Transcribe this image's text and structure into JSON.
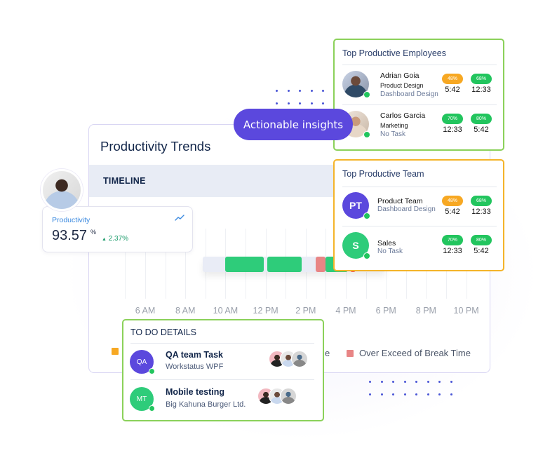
{
  "colors": {
    "brand_purple": "#5b48dd",
    "success_green": "#22c55e",
    "warning_orange": "#f7a823",
    "productive_bar": "#2ecc7a",
    "break_exceed": "#e88585",
    "over_break": "#f0505a",
    "idle": "#e9ecf6",
    "employees_border": "#8bd15a",
    "team_border": "#f4b42a"
  },
  "pill": {
    "label": "Actionable insights"
  },
  "main": {
    "title": "Productivity Trends",
    "timeline_label": "TIMELINE",
    "time_axis": [
      "6 AM",
      "8 AM",
      "10 AM",
      "12 PM",
      "2 PM",
      "4 PM",
      "6 PM",
      "8 PM",
      "10 PM"
    ],
    "timeline_segments": [
      {
        "type": "productive",
        "start_hour": 10.0,
        "end_hour": 12.0
      },
      {
        "type": "productive",
        "start_hour": 12.1,
        "end_hour": 13.9
      },
      {
        "type": "idle",
        "start_hour": 13.9,
        "end_hour": 14.5
      },
      {
        "type": "break_exceed",
        "start_hour": 14.5,
        "end_hour": 15.0
      },
      {
        "type": "productive",
        "start_hour": 15.0,
        "end_hour": 16.2
      },
      {
        "type": "over_break",
        "start_hour": 16.2,
        "end_hour": 16.5
      }
    ],
    "legend": [
      {
        "label": "",
        "color": "#f7a823"
      },
      {
        "label": "e",
        "color": ""
      },
      {
        "label": "Over Exceed of Break Time",
        "color": "#e88585"
      }
    ]
  },
  "productivity": {
    "label": "Productivity",
    "value": "93.57",
    "unit": "%",
    "delta": "2.37%",
    "delta_direction": "up"
  },
  "employees": {
    "title": "Top Productive Employees",
    "rows": [
      {
        "name": "Adrian Goia",
        "department": "Product Design",
        "task": "Dashboard Design",
        "metrics": [
          {
            "percent": "48%",
            "time": "5:42",
            "tone": "orange"
          },
          {
            "percent": "68%",
            "time": "12:33",
            "tone": "green"
          }
        ]
      },
      {
        "name": "Carlos Garcia",
        "department": "Marketing",
        "task": "No Task",
        "metrics": [
          {
            "percent": "70%",
            "time": "12:33",
            "tone": "green"
          },
          {
            "percent": "80%",
            "time": "5:42",
            "tone": "green"
          }
        ]
      }
    ]
  },
  "team": {
    "title": "Top Productive Team",
    "rows": [
      {
        "initials": "PT",
        "name": "Product Team",
        "task": "Dashboard Design",
        "avatar_color": "#5b48dd",
        "metrics": [
          {
            "percent": "48%",
            "time": "5:42",
            "tone": "orange"
          },
          {
            "percent": "68%",
            "time": "12:33",
            "tone": "green"
          }
        ]
      },
      {
        "initials": "S",
        "name": "Sales",
        "task": "No Task",
        "avatar_color": "#2ecc7a",
        "metrics": [
          {
            "percent": "70%",
            "time": "12:33",
            "tone": "green"
          },
          {
            "percent": "80%",
            "time": "5:42",
            "tone": "green"
          }
        ]
      }
    ]
  },
  "todo": {
    "title": "TO DO DETAILS",
    "items": [
      {
        "initials": "QA",
        "name": "QA team Task",
        "project": "Workstatus WPF",
        "avatar_color": "#5b48dd"
      },
      {
        "initials": "MT",
        "name": "Mobile testing",
        "project": "Big Kahuna Burger Ltd.",
        "avatar_color": "#2ecc7a"
      }
    ]
  }
}
